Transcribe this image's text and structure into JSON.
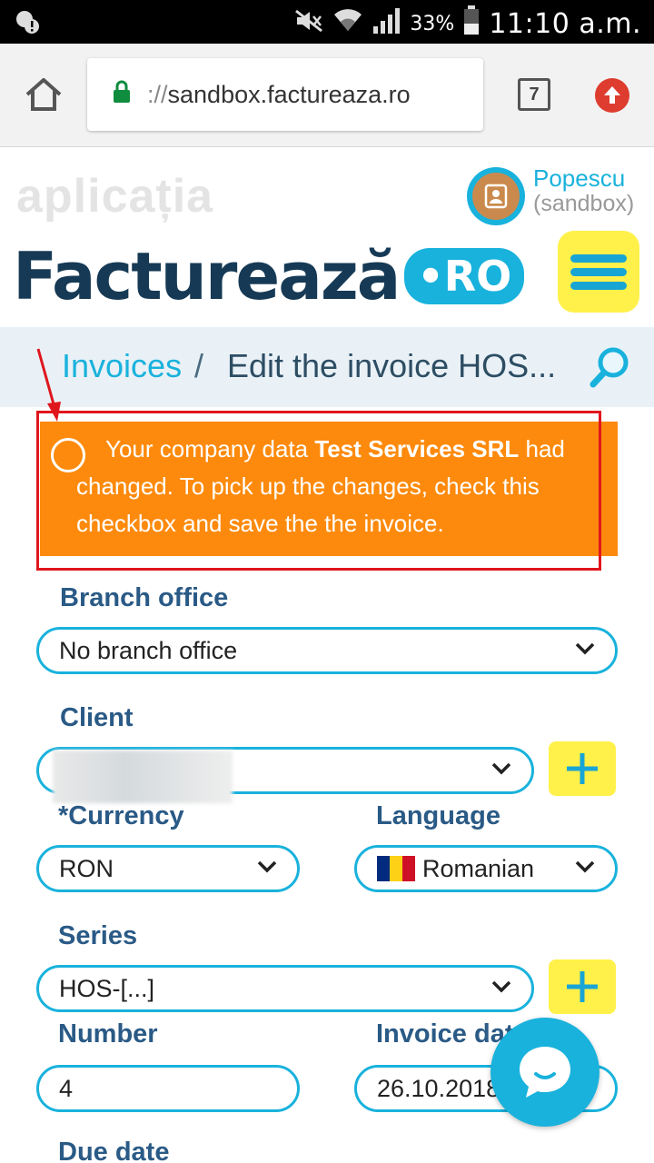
{
  "status_bar": {
    "battery_pct": "33%",
    "time": "11:10 a.m."
  },
  "browser": {
    "url_scheme": "://",
    "url_host": "sandbox.factureaza.ro",
    "tab_count": "7"
  },
  "header": {
    "brand_top": "aplicația",
    "brand_word": "Facturează",
    "brand_ro": "•RO",
    "user_name": "Popescu",
    "user_sub": "(sandbox)"
  },
  "breadcrumb": {
    "parent": "Invoices",
    "separator": "/",
    "current": "Edit the invoice HOS..."
  },
  "alert": {
    "text_before": "Your company data ",
    "company": "Test Services SRL",
    "text_after": " had changed. To pick up the changes, check this checkbox and save the the invoice."
  },
  "form": {
    "branch_label": "Branch office",
    "branch_value": "No branch office",
    "client_label": "Client",
    "currency_label": "*Currency",
    "currency_value": "RON",
    "language_label": "Language",
    "language_value": "Romanian",
    "series_label": "Series",
    "series_value": "HOS-[...]",
    "number_label": "Number",
    "number_value": "4",
    "invoice_date_label": "Invoice date",
    "invoice_date_value": "26.10.2018",
    "due_date_label": "Due date"
  },
  "colors": {
    "accent": "#19b2dc",
    "alert": "#fd8a0c",
    "highlight": "#e0161d",
    "button": "#fff14a",
    "label": "#2a5a86"
  }
}
